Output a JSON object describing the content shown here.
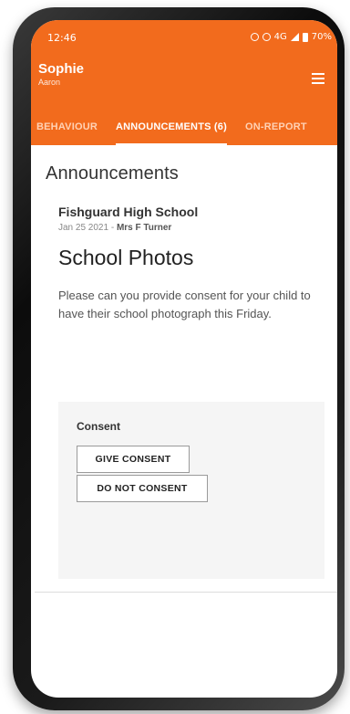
{
  "status_bar": {
    "time": "12:46",
    "network": "4G",
    "battery": "70%"
  },
  "header": {
    "name": "Sophie",
    "sub": "Aaron",
    "menu_icon": "hamburger-icon"
  },
  "tabs": [
    {
      "label": "BEHAVIOUR",
      "active": false
    },
    {
      "label": "ANNOUNCEMENTS (6)",
      "active": true
    },
    {
      "label": "ON-REPORT",
      "active": false
    }
  ],
  "page": {
    "title": "Announcements"
  },
  "announcement": {
    "school": "Fishguard High School",
    "date": "Jan 25 2021 - ",
    "author": "Mrs F Turner",
    "title": "School Photos",
    "body": "Please can you provide consent for your child to have their school photograph this Friday."
  },
  "consent": {
    "label": "Consent",
    "give_label": "GIVE CONSENT",
    "deny_label": "DO NOT CONSENT"
  },
  "colors": {
    "accent": "#f26b1d"
  }
}
